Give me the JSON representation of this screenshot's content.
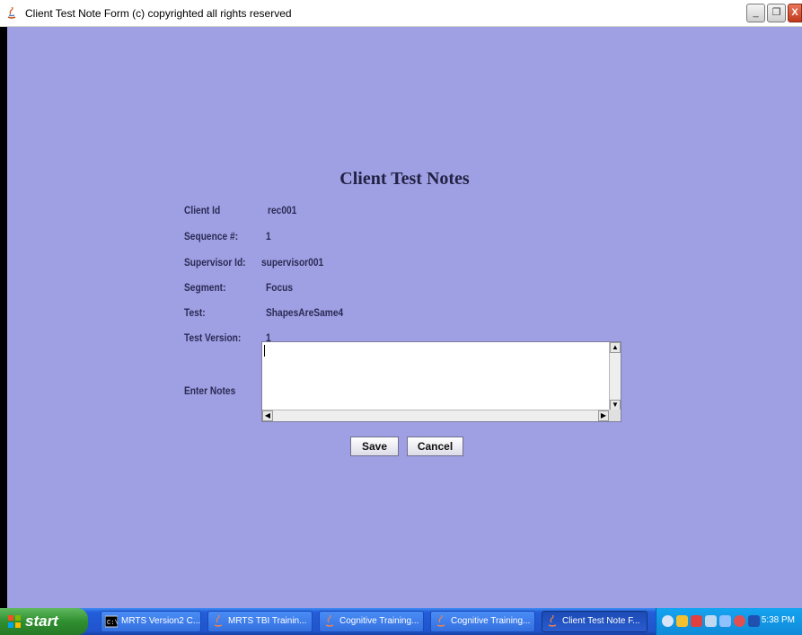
{
  "window": {
    "title": "Client Test Note Form (c) copyrighted  all rights reserved",
    "controls": {
      "minimize": "_",
      "restore": "❐",
      "close": "X"
    }
  },
  "form": {
    "heading": "Client Test Notes",
    "fields": [
      {
        "label": "Client Id",
        "value": "rec001"
      },
      {
        "label": "Sequence #:",
        "value": "1"
      },
      {
        "label": "Supervisor Id:",
        "value": "supervisor001"
      },
      {
        "label": "Segment:",
        "value": "Focus"
      },
      {
        "label": "Test:",
        "value": "ShapesAreSame4"
      },
      {
        "label": "Test Version:",
        "value": "1"
      }
    ],
    "notes_label": "Enter Notes",
    "notes_value": "",
    "save_label": "Save",
    "cancel_label": "Cancel"
  },
  "taskbar": {
    "start_label": "start",
    "items": [
      {
        "label": "MRTS Version2  C...",
        "icon": "console-icon"
      },
      {
        "label": "MRTS TBI Trainin...",
        "icon": "java-icon"
      },
      {
        "label": "Cognitive Training...",
        "icon": "java-icon"
      },
      {
        "label": "Cognitive Training...",
        "icon": "java-icon"
      },
      {
        "label": "Client Test Note F...",
        "icon": "java-icon"
      }
    ],
    "clock": "5:38 PM"
  },
  "colors": {
    "background": "#9f9fe3",
    "label_text": "#2b2b55",
    "taskbar": "#245edb",
    "start_button": "#2f8f2f"
  }
}
